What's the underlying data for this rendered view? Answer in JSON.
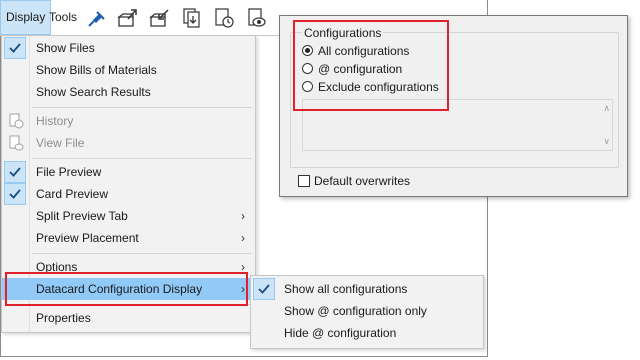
{
  "menubar": {
    "display_label": "Display",
    "tools_label": "Tools",
    "toolbar_icons": [
      "pin-icon",
      "check-out-icon",
      "check-in-icon",
      "get-latest-icon",
      "change-state-icon",
      "view-icon"
    ]
  },
  "display_menu": {
    "items": [
      {
        "label": "Show Files",
        "checked": true
      },
      {
        "label": "Show Bills of Materials"
      },
      {
        "label": "Show Search Results"
      },
      {
        "label": "History",
        "disabled": true
      },
      {
        "label": "View File",
        "disabled": true
      },
      {
        "label": "File Preview",
        "checked": true
      },
      {
        "label": "Card Preview",
        "checked": true
      },
      {
        "label": "Split Preview Tab",
        "submenu": true
      },
      {
        "label": "Preview Placement",
        "submenu": true
      },
      {
        "label": "Options",
        "submenu": true
      },
      {
        "label": "Datacard Configuration Display",
        "submenu": true,
        "highlighted": true
      },
      {
        "label": "Properties"
      }
    ],
    "arrow_glyph": "›"
  },
  "submenu": {
    "items": [
      {
        "label": "Show all configurations",
        "checked": true
      },
      {
        "label": "Show @ configuration only"
      },
      {
        "label": "Hide @ configuration"
      }
    ]
  },
  "config_panel": {
    "group_title": "Configurations",
    "options": [
      {
        "label": "All configurations",
        "selected": true
      },
      {
        "label": "@ configuration",
        "selected": false
      },
      {
        "label": "Exclude configurations",
        "selected": false
      }
    ],
    "checkbox_label": "Default overwrites",
    "checkbox_checked": false
  },
  "colors": {
    "highlight": "#91c9f7",
    "check_bg": "#cce4f7",
    "annotation_red": "#e0202a"
  }
}
